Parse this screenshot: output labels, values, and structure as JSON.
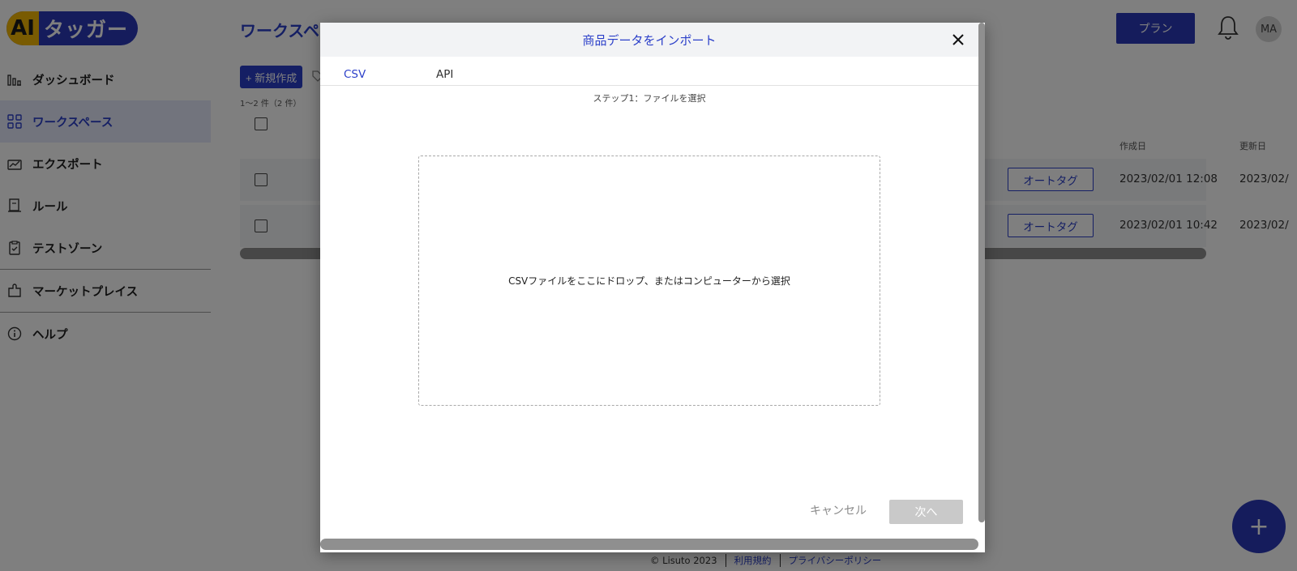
{
  "logo": {
    "ai": "AI",
    "text": "タッガー"
  },
  "sidebar": {
    "items": [
      {
        "label": "ダッシュボード",
        "icon": "bar-chart-icon"
      },
      {
        "label": "ワークスペース",
        "icon": "grid-icon",
        "active": true
      },
      {
        "label": "エクスポート",
        "icon": "export-chart-icon"
      },
      {
        "label": "ルール",
        "icon": "scroll-icon"
      },
      {
        "label": "テストゾーン",
        "icon": "clipboard-check-icon"
      },
      {
        "label": "マーケットプレイス",
        "icon": "puzzle-icon"
      },
      {
        "label": "ヘルプ",
        "icon": "info-icon"
      }
    ]
  },
  "page": {
    "title": "ワークスペ",
    "new_button": "+ 新規作成",
    "count_text": "1～2 件（2 件）",
    "columns": {
      "created": "作成日",
      "updated": "更新日"
    },
    "rows": [
      {
        "action": "オートタグ",
        "created": "2023/02/01 12:08",
        "updated": "2023/02/"
      },
      {
        "action": "オートタグ",
        "created": "2023/02/01 10:42",
        "updated": "2023/02/"
      }
    ]
  },
  "header": {
    "plan_button": "プラン",
    "avatar_initials": "MA"
  },
  "fab_label": "+",
  "footer": {
    "copyright": "© Lisuto 2023",
    "terms": "利用規約",
    "privacy": "プライバシーポリシー"
  },
  "modal": {
    "title": "商品データをインポート",
    "tabs": [
      {
        "label": "CSV",
        "active": true
      },
      {
        "label": "API",
        "active": false
      }
    ],
    "step": "ステップ1：ファイルを選択",
    "drop_text": "CSVファイルをここにドロップ、またはコンピューターから選択",
    "cancel": "キャンセル",
    "next": "次へ"
  },
  "colors": {
    "accent": "#2b3fc9",
    "logo_yellow": "#f2b705",
    "logo_blue": "#2b38b8",
    "overlay": "rgba(0,0,0,0.5)"
  }
}
